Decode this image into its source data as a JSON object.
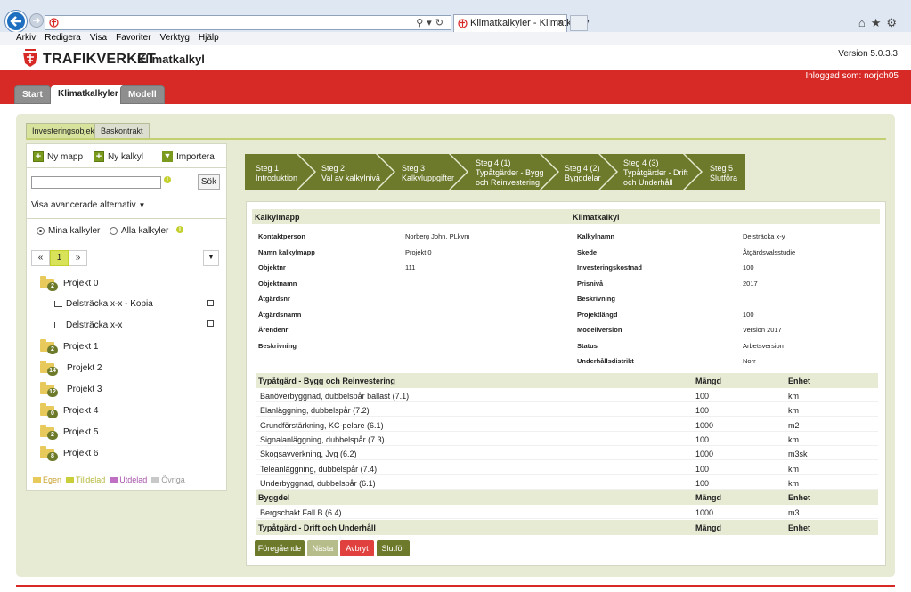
{
  "browser": {
    "tab_title": "Klimatkalkyler - Klimatkalkyl",
    "menu": [
      "Arkiv",
      "Redigera",
      "Visa",
      "Favoriter",
      "Verktyg",
      "Hjälp"
    ]
  },
  "header": {
    "brand": "TRAFIKVERKET",
    "app_title": "Klimatkalkyl",
    "version": "Version 5.0.3.3",
    "logged_in": "Inloggad som: norjoh05"
  },
  "main_tabs": [
    "Start",
    "Klimatkalkyler",
    "Modell"
  ],
  "sub_tabs": [
    "Investeringsobjekt",
    "Baskontrakt"
  ],
  "left": {
    "new_folder": "Ny mapp",
    "new_calc": "Ny kalkyl",
    "import": "Importera",
    "search_button": "Sök",
    "advanced": "Visa avancerade alternativ",
    "radio_mine": "Mina kalkyler",
    "radio_all": "Alla kalkyler",
    "pager": [
      "«",
      "1",
      "»"
    ],
    "projects": [
      {
        "name": "Projekt 0",
        "count": "2"
      },
      {
        "name": "Projekt 1",
        "count": "2"
      },
      {
        "name": "Projekt 2",
        "count": "14"
      },
      {
        "name": "Projekt 3",
        "count": "12"
      },
      {
        "name": "Projekt 4",
        "count": "0"
      },
      {
        "name": "Projekt 5",
        "count": "2"
      },
      {
        "name": "Projekt 6",
        "count": "8"
      }
    ],
    "calcs": [
      "Delsträcka x-x - Kopia",
      "Delsträcka x-x"
    ],
    "legend": [
      "Egen",
      "Tilldelad",
      "Utdelad",
      "Övriga"
    ],
    "legend_colors": [
      "#e8c95b",
      "#c9cf3a",
      "#c070c4",
      "#c8c8c8"
    ]
  },
  "steps": [
    {
      "l1": "Steg 1",
      "l2": "Introduktion",
      "l3": ""
    },
    {
      "l1": "Steg 2",
      "l2": "Val av kalkylnivå",
      "l3": ""
    },
    {
      "l1": "Steg 3",
      "l2": "Kalkyluppgifter",
      "l3": ""
    },
    {
      "l1": "Steg 4 (1)",
      "l2": "Typåtgärder - Bygg",
      "l3": "och Reinvestering"
    },
    {
      "l1": "Steg 4 (2)",
      "l2": "Byggdelar",
      "l3": ""
    },
    {
      "l1": "Steg 4 (3)",
      "l2": "Typåtgärder - Drift",
      "l3": "och Underhåll"
    },
    {
      "l1": "Steg 5",
      "l2": "Slutföra",
      "l3": ""
    }
  ],
  "summary": {
    "col1_title": "Kalkylmapp",
    "col2_title": "Klimatkalkyl",
    "col1": [
      {
        "label": "Kontaktperson",
        "value": "Norberg John, PLkvm"
      },
      {
        "label": "Namn kalkylmapp",
        "value": "Projekt 0"
      },
      {
        "label": "Objektnr",
        "value": "111"
      },
      {
        "label": "Objektnamn",
        "value": ""
      },
      {
        "label": "Åtgärdsnr",
        "value": ""
      },
      {
        "label": "Åtgärdsnamn",
        "value": ""
      },
      {
        "label": "Ärendenr",
        "value": ""
      },
      {
        "label": "Beskrivning",
        "value": ""
      }
    ],
    "col2": [
      {
        "label": "Kalkylnamn",
        "value": "Delsträcka x-y"
      },
      {
        "label": "Skede",
        "value": "Åtgärdsvalsstudie"
      },
      {
        "label": "Investeringskostnad",
        "value": "100"
      },
      {
        "label": "Prisnivå",
        "value": "2017"
      },
      {
        "label": "Beskrivning",
        "value": ""
      },
      {
        "label": "Projektlängd",
        "value": "100"
      },
      {
        "label": "Modellversion",
        "value": "Version 2017"
      },
      {
        "label": "Status",
        "value": "Arbetsversion"
      },
      {
        "label": "Underhållsdistrikt",
        "value": "Norr"
      }
    ]
  },
  "tables": {
    "typ_bygg": {
      "title": "Typåtgärd - Bygg och Reinvestering",
      "col_qty": "Mängd",
      "col_unit": "Enhet",
      "rows": [
        {
          "name": "Banöverbyggnad, dubbelspår ballast (7.1)",
          "qty": "100",
          "unit": "km"
        },
        {
          "name": "Elanläggning, dubbelspår (7.2)",
          "qty": "100",
          "unit": "km"
        },
        {
          "name": "Grundförstärkning, KC-pelare (6.1)",
          "qty": "1000",
          "unit": "m2"
        },
        {
          "name": "Signalanläggning, dubbelspår (7.3)",
          "qty": "100",
          "unit": "km"
        },
        {
          "name": "Skogsavverkning, Jvg (6.2)",
          "qty": "1000",
          "unit": "m3sk"
        },
        {
          "name": "Teleanläggning, dubbelspår (7.4)",
          "qty": "100",
          "unit": "km"
        },
        {
          "name": "Underbyggnad, dubbelspår (6.1)",
          "qty": "100",
          "unit": "km"
        }
      ]
    },
    "byggdel": {
      "title": "Byggdel",
      "col_qty": "Mängd",
      "col_unit": "Enhet",
      "rows": [
        {
          "name": "Bergschakt Fall B (6.4)",
          "qty": "1000",
          "unit": "m3"
        }
      ]
    },
    "typ_drift": {
      "title": "Typåtgärd - Drift och Underhåll",
      "col_qty": "Mängd",
      "col_unit": "Enhet"
    }
  },
  "buttons": {
    "prev": "Föregående",
    "next": "Nästa",
    "cancel": "Avbryt",
    "finish": "Slutför"
  }
}
